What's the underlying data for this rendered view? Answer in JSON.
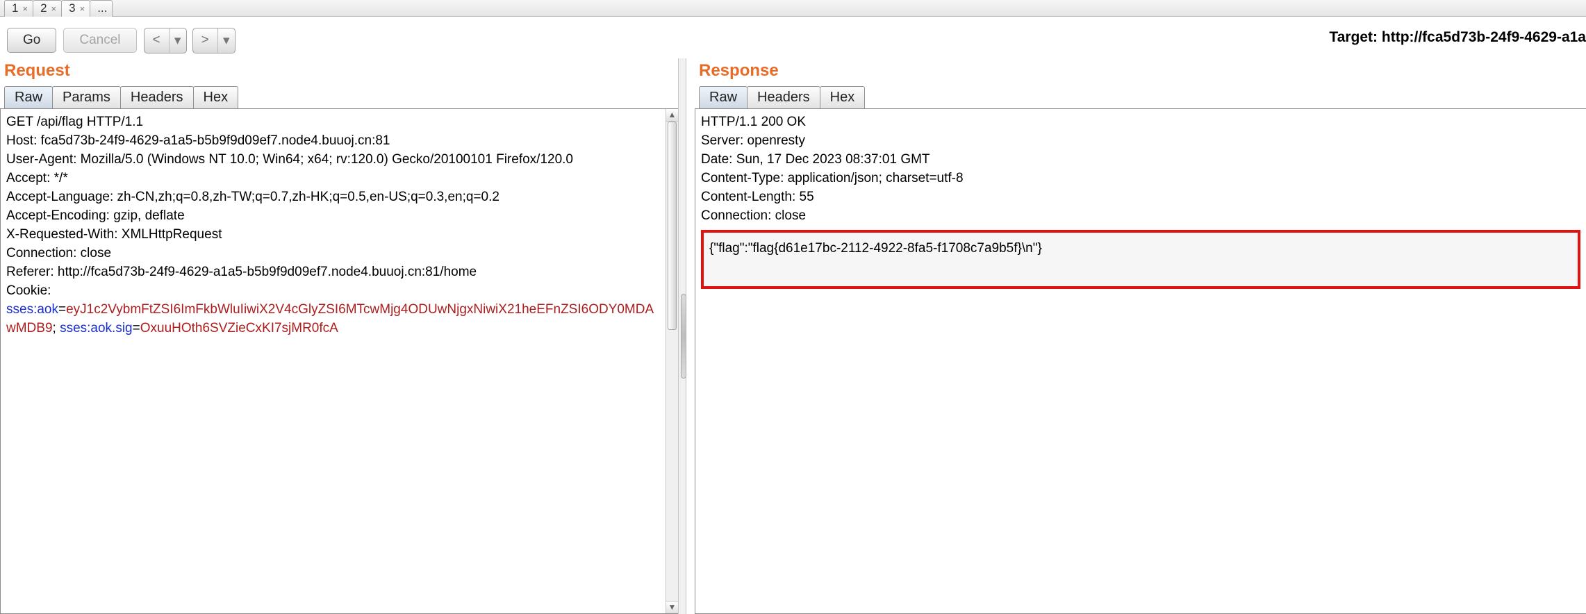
{
  "top_tabs": {
    "items": [
      {
        "label": "1"
      },
      {
        "label": "2"
      },
      {
        "label": "3"
      },
      {
        "label": "..."
      }
    ],
    "active_index": 2
  },
  "toolbar": {
    "go_label": "Go",
    "cancel_label": "Cancel",
    "target_prefix": "Target: ",
    "target_value": "http://fca5d73b-24f9-4629-a1a"
  },
  "request": {
    "title": "Request",
    "tabs": [
      "Raw",
      "Params",
      "Headers",
      "Hex"
    ],
    "active_tab_index": 0,
    "lines": {
      "l0": "GET /api/flag HTTP/1.1",
      "l1": "Host: fca5d73b-24f9-4629-a1a5-b5b9f9d09ef7.node4.buuoj.cn:81",
      "l2": "User-Agent: Mozilla/5.0 (Windows NT 10.0; Win64; x64; rv:120.0) Gecko/20100101 Firefox/120.0",
      "l3": "Accept: */*",
      "l4": "Accept-Language: zh-CN,zh;q=0.8,zh-TW;q=0.7,zh-HK;q=0.5,en-US;q=0.3,en;q=0.2",
      "l5": "Accept-Encoding: gzip, deflate",
      "l6": "X-Requested-With: XMLHttpRequest",
      "l7": "Connection: close",
      "l8": "Referer: http://fca5d73b-24f9-4629-a1a5-b5b9f9d09ef7.node4.buuoj.cn:81/home",
      "l9": "Cookie:",
      "cookie1_key": "sses:aok",
      "eq1": "=",
      "cookie1_val": "eyJ1c2VybmFtZSI6ImFkbWluIiwiX2V4cGlyZSI6MTcwMjg4ODUwNjgxNiwiX21heEFnZSI6ODY0MDAwMDB9",
      "sep": "; ",
      "cookie2_key": "sses:aok.sig",
      "eq2": "=",
      "cookie2_val": "OxuuHOth6SVZieCxKI7sjMR0fcA"
    }
  },
  "response": {
    "title": "Response",
    "tabs": [
      "Raw",
      "Headers",
      "Hex"
    ],
    "active_tab_index": 0,
    "lines": {
      "l0": "HTTP/1.1 200 OK",
      "l1": "Server: openresty",
      "l2": "Date: Sun, 17 Dec 2023 08:37:01 GMT",
      "l3": "Content-Type: application/json; charset=utf-8",
      "l4": "Content-Length: 55",
      "l5": "Connection: close"
    },
    "body": "{\"flag\":\"flag{d61e17bc-2112-4922-8fa5-f1708c7a9b5f}\\n\"}"
  }
}
